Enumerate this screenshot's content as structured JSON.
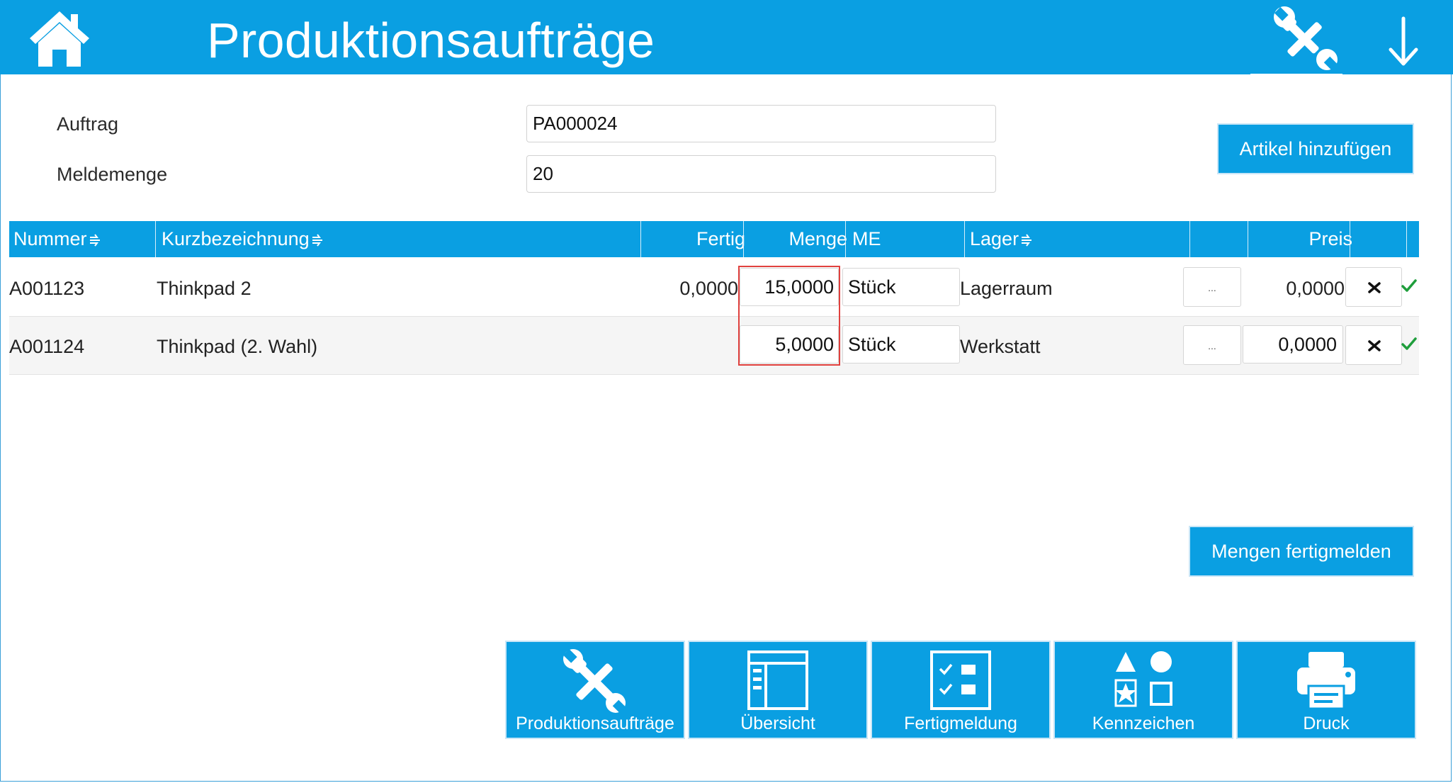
{
  "header": {
    "title": "Produktionsaufträge",
    "home_icon": "home-icon",
    "tools_icon": "tools-icon",
    "down_icon": "arrow-down-icon"
  },
  "form": {
    "auftrag_label": "Auftrag",
    "auftrag_value": "PA000024",
    "meldemenge_label": "Meldemenge",
    "meldemenge_value": "20",
    "add_article_label": "Artikel hinzufügen"
  },
  "table": {
    "columns": {
      "nummer": "Nummer",
      "kurzbezeichnung": "Kurzbezeichnung",
      "fertig": "Fertig",
      "menge": "Menge",
      "me": "ME",
      "lager": "Lager",
      "preis": "Preis"
    },
    "rows": [
      {
        "nummer": "A001123",
        "kurzbezeichnung": "Thinkpad 2",
        "fertig": "0,0000",
        "menge": "15,0000",
        "me": "Stück",
        "lager": "Lagerraum",
        "ellipsis": "...",
        "preis": "0,0000"
      },
      {
        "nummer": "A001124",
        "kurzbezeichnung": "Thinkpad (2. Wahl)",
        "fertig": "",
        "menge": "5,0000",
        "me": "Stück",
        "lager": "Werkstatt",
        "ellipsis": "...",
        "preis": "0,0000"
      }
    ]
  },
  "actions": {
    "report_quantities_label": "Mengen fertigmelden"
  },
  "bottom_nav": [
    {
      "label": "Produktionsaufträge",
      "icon": "tools-icon"
    },
    {
      "label": "Übersicht",
      "icon": "overview-icon"
    },
    {
      "label": "Fertigmeldung",
      "icon": "checklist-icon"
    },
    {
      "label": "Kennzeichen",
      "icon": "shapes-icon"
    },
    {
      "label": "Druck",
      "icon": "printer-icon"
    }
  ],
  "colors": {
    "accent": "#0a9fe2",
    "highlight": "#e0413e",
    "check": "#1f9e3c"
  }
}
